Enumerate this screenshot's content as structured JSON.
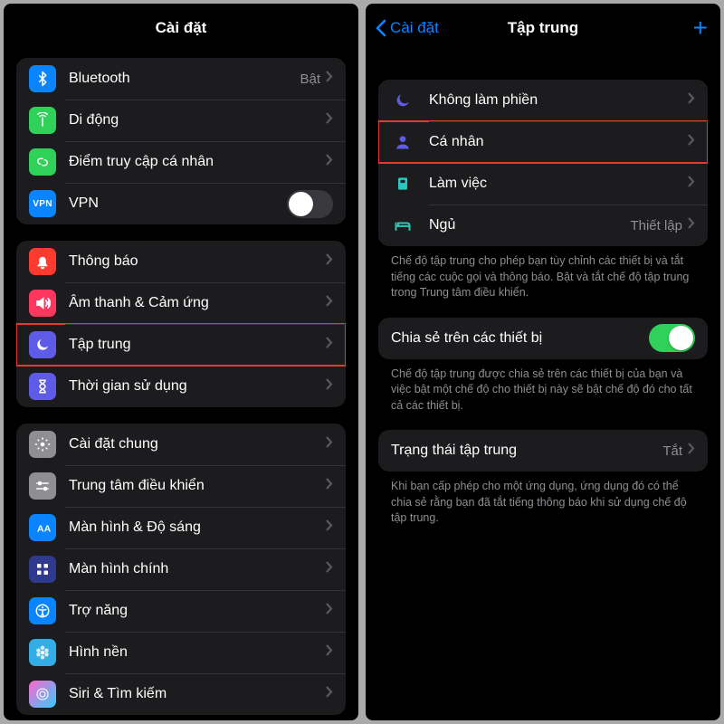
{
  "left": {
    "title": "Cài đặt",
    "group1": [
      {
        "key": "bluetooth",
        "label": "Bluetooth",
        "value": "Bật",
        "iconBg": "#0a84ff"
      },
      {
        "key": "cellular",
        "label": "Di động",
        "value": "",
        "iconBg": "#30d158"
      },
      {
        "key": "hotspot",
        "label": "Điểm truy cập cá nhân",
        "value": "",
        "iconBg": "#30d158"
      },
      {
        "key": "vpn",
        "label": "VPN",
        "toggle": "off"
      }
    ],
    "group2": [
      {
        "key": "notifications",
        "label": "Thông báo",
        "iconBg": "#ff3b30"
      },
      {
        "key": "sounds",
        "label": "Âm thanh & Cảm ứng",
        "iconBg": "#ff375f"
      },
      {
        "key": "focus",
        "label": "Tập trung",
        "iconBg": "#5e5ce6",
        "highlight": true
      },
      {
        "key": "screentime",
        "label": "Thời gian sử dụng",
        "iconBg": "#5e5ce6"
      }
    ],
    "group3": [
      {
        "key": "general",
        "label": "Cài đặt chung",
        "iconBg": "#8e8e93"
      },
      {
        "key": "controlcenter",
        "label": "Trung tâm điều khiển",
        "iconBg": "#8e8e93"
      },
      {
        "key": "display",
        "label": "Màn hình & Độ sáng",
        "iconBg": "#0a84ff"
      },
      {
        "key": "homescreen",
        "label": "Màn hình chính",
        "iconBg": "#3551b5"
      },
      {
        "key": "accessibility",
        "label": "Trợ năng",
        "iconBg": "#0a84ff"
      },
      {
        "key": "wallpaper",
        "label": "Hình nền",
        "iconBg": "#32ade6"
      },
      {
        "key": "siri",
        "label": "Siri & Tìm kiếm",
        "iconBg": "#1c1c1e"
      }
    ]
  },
  "right": {
    "back": "Cài đặt",
    "title": "Tập trung",
    "modes": [
      {
        "key": "dnd",
        "label": "Không làm phiền",
        "value": "",
        "color": "#5e5ce6"
      },
      {
        "key": "personal",
        "label": "Cá nhân",
        "value": "",
        "color": "#5e5ce6",
        "highlight": true
      },
      {
        "key": "work",
        "label": "Làm việc",
        "value": "",
        "color": "#28c8be"
      },
      {
        "key": "sleep",
        "label": "Ngủ",
        "value": "Thiết lập",
        "color": "#2fc6b6"
      }
    ],
    "footer1": "Chế độ tập trung cho phép bạn tùy chỉnh các thiết bị và tắt tiếng các cuộc gọi và thông báo. Bật và tắt chế độ tập trung trong Trung tâm điều khiển.",
    "share_label": "Chia sẻ trên các thiết bị",
    "share_toggle": "on",
    "footer2": "Chế độ tập trung được chia sẻ trên các thiết bị của bạn và việc bật một chế độ cho thiết bị này sẽ bật chế độ đó cho tất cả các thiết bị.",
    "status_label": "Trạng thái tập trung",
    "status_value": "Tắt",
    "footer3": "Khi bạn cấp phép cho một ứng dụng, ứng dụng đó có thể chia sẻ rằng bạn đã tắt tiếng thông báo khi sử dụng chế độ tập trung."
  }
}
